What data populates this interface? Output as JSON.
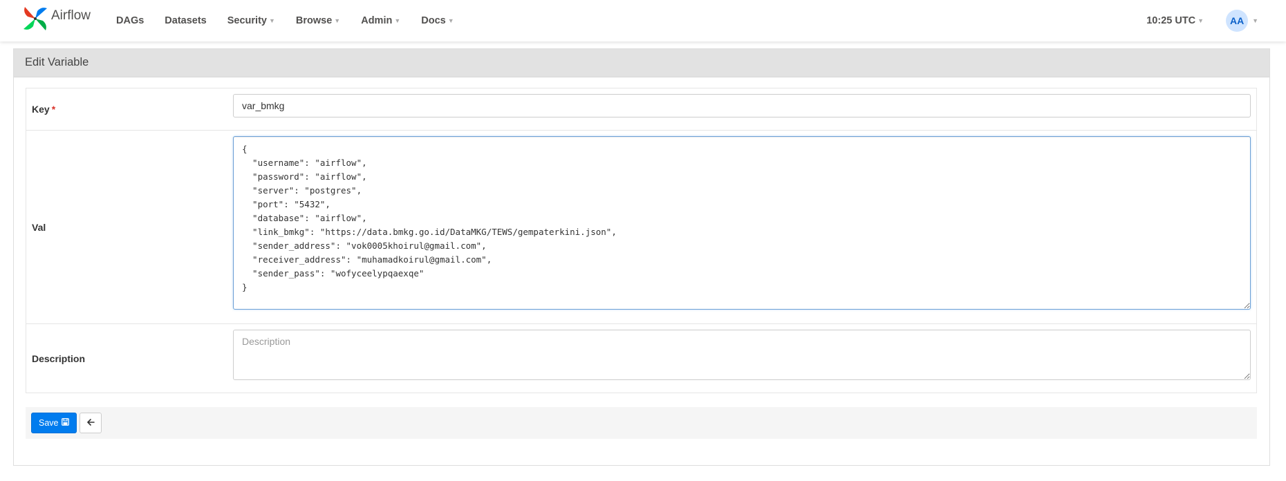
{
  "brand": {
    "name": "Airflow",
    "logo_icon": "airflow-pinwheel-icon"
  },
  "nav": {
    "items": [
      {
        "label": "DAGs",
        "dropdown": false
      },
      {
        "label": "Datasets",
        "dropdown": false
      },
      {
        "label": "Security",
        "dropdown": true
      },
      {
        "label": "Browse",
        "dropdown": true
      },
      {
        "label": "Admin",
        "dropdown": true
      },
      {
        "label": "Docs",
        "dropdown": true
      }
    ],
    "clock": "10:25 UTC",
    "user_initials": "AA"
  },
  "panel": {
    "title": "Edit Variable"
  },
  "form": {
    "key": {
      "label": "Key",
      "required_mark": "*",
      "value": "var_bmkg"
    },
    "val": {
      "label": "Val",
      "value": "{\n  \"username\": \"airflow\",\n  \"password\": \"airflow\",\n  \"server\": \"postgres\",\n  \"port\": \"5432\",\n  \"database\": \"airflow\",\n  \"link_bmkg\": \"https://data.bmkg.go.id/DataMKG/TEWS/gempaterkini.json\",\n  \"sender_address\": \"vok0005khoirul@gmail.com\",\n  \"receiver_address\": \"muhamadkoirul@gmail.com\",\n  \"sender_pass\": \"wofyceelypqaexqe\"\n}"
    },
    "description": {
      "label": "Description",
      "placeholder": "Description",
      "value": ""
    }
  },
  "actions": {
    "save_label": "Save",
    "save_icon": "floppy-disk-icon",
    "back_icon": "arrow-left-icon"
  },
  "colors": {
    "primary": "#017cee",
    "required": "#d9342b",
    "avatar_bg": "#cfe4ff",
    "avatar_text": "#0c61c9"
  }
}
